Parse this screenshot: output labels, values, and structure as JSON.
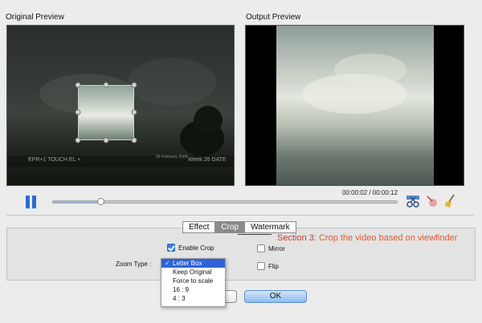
{
  "original_preview": {
    "label": "Original Preview"
  },
  "output_preview": {
    "label": "Output Preview"
  },
  "overlay": {
    "left_text": "EPR+1 TOUCH EL +",
    "right_text": "Week 26 DATE",
    "small_text": "26 February 2004"
  },
  "playback": {
    "time": "00:00:02 / 00:00:12",
    "progress_fraction": 0.14
  },
  "tabs": [
    {
      "label": "Effect",
      "selected": false
    },
    {
      "label": "Crop",
      "selected": true
    },
    {
      "label": "Watermark",
      "selected": false
    }
  ],
  "annotation": {
    "lead": "Section 3:",
    "text": " Crop the video based on viewfinder"
  },
  "crop_panel": {
    "enable_crop_label": "Enable Crop",
    "enable_crop_checked": true,
    "mirror_label": "Mirror",
    "mirror_checked": false,
    "flip_label": "Flip",
    "flip_checked": false,
    "zoom_type_label": "Zoom Type :"
  },
  "zoom_menu": {
    "selected": "Letter Box",
    "options": [
      "Letter Box",
      "Keep Original",
      "Force to scale",
      "16 : 9",
      "4 : 3"
    ]
  },
  "buttons": {
    "cancel": "Cancel",
    "ok": "OK"
  },
  "colors": {
    "accent_blue": "#2f63d9",
    "annotation_orange": "#e05a33",
    "pause_blue": "#2a6fd6"
  }
}
